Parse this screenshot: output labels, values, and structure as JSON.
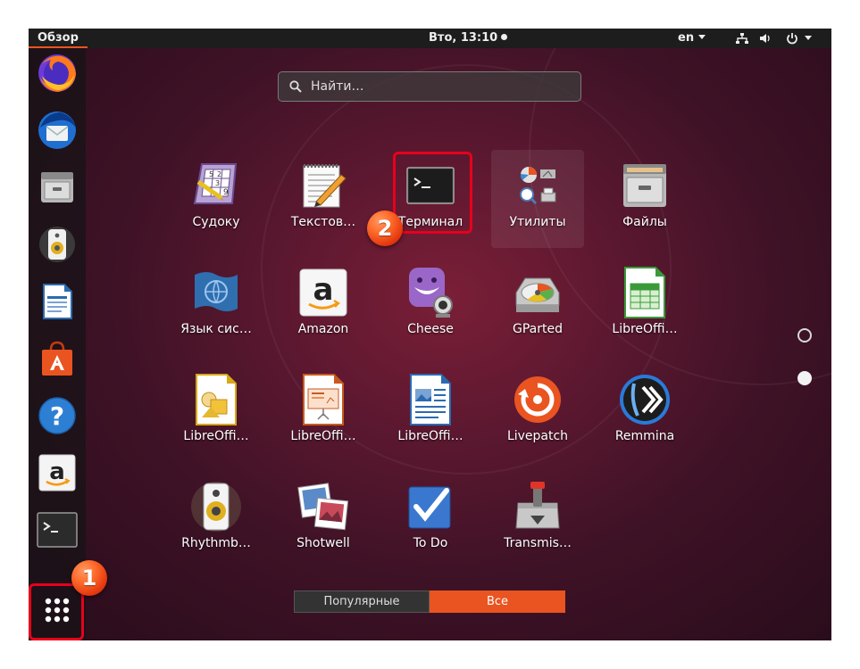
{
  "topbar": {
    "activities": "Обзор",
    "clock": "Вто, 13:10",
    "language": "en"
  },
  "search": {
    "placeholder": "Найти…"
  },
  "apps": [
    {
      "label": "Судоку",
      "icon": "sudoku-icon"
    },
    {
      "label": "Текстов…",
      "icon": "text-editor-icon"
    },
    {
      "label": "Терминал",
      "icon": "terminal-icon"
    },
    {
      "label": "Утилиты",
      "icon": "utilities-folder-icon"
    },
    {
      "label": "Файлы",
      "icon": "files-icon"
    },
    {
      "label": "Язык сис…",
      "icon": "language-support-icon"
    },
    {
      "label": "Amazon",
      "icon": "amazon-icon"
    },
    {
      "label": "Cheese",
      "icon": "cheese-icon"
    },
    {
      "label": "GParted",
      "icon": "gparted-icon"
    },
    {
      "label": "LibreOffi…",
      "icon": "libreoffice-calc-icon"
    },
    {
      "label": "LibreOffi…",
      "icon": "libreoffice-draw-icon"
    },
    {
      "label": "LibreOffi…",
      "icon": "libreoffice-impress-icon"
    },
    {
      "label": "LibreOffi…",
      "icon": "libreoffice-writer-icon"
    },
    {
      "label": "Livepatch",
      "icon": "livepatch-icon"
    },
    {
      "label": "Remmina",
      "icon": "remmina-icon"
    },
    {
      "label": "Rhythmb…",
      "icon": "rhythmbox-icon"
    },
    {
      "label": "Shotwell",
      "icon": "shotwell-icon"
    },
    {
      "label": "To Do",
      "icon": "todo-icon"
    },
    {
      "label": "Transmis…",
      "icon": "transmission-icon"
    }
  ],
  "dock": [
    "firefox-icon",
    "thunderbird-icon",
    "files-icon",
    "rhythmbox-icon",
    "libreoffice-writer-icon",
    "ubuntu-software-icon",
    "help-icon",
    "amazon-icon",
    "terminal-icon",
    "show-applications-icon"
  ],
  "tabs": {
    "popular": "Популярные",
    "all": "Все"
  },
  "annotations": {
    "marker_1": "1",
    "marker_2": "2"
  },
  "colors": {
    "accent": "#e95420",
    "highlight": "#e8001c"
  }
}
